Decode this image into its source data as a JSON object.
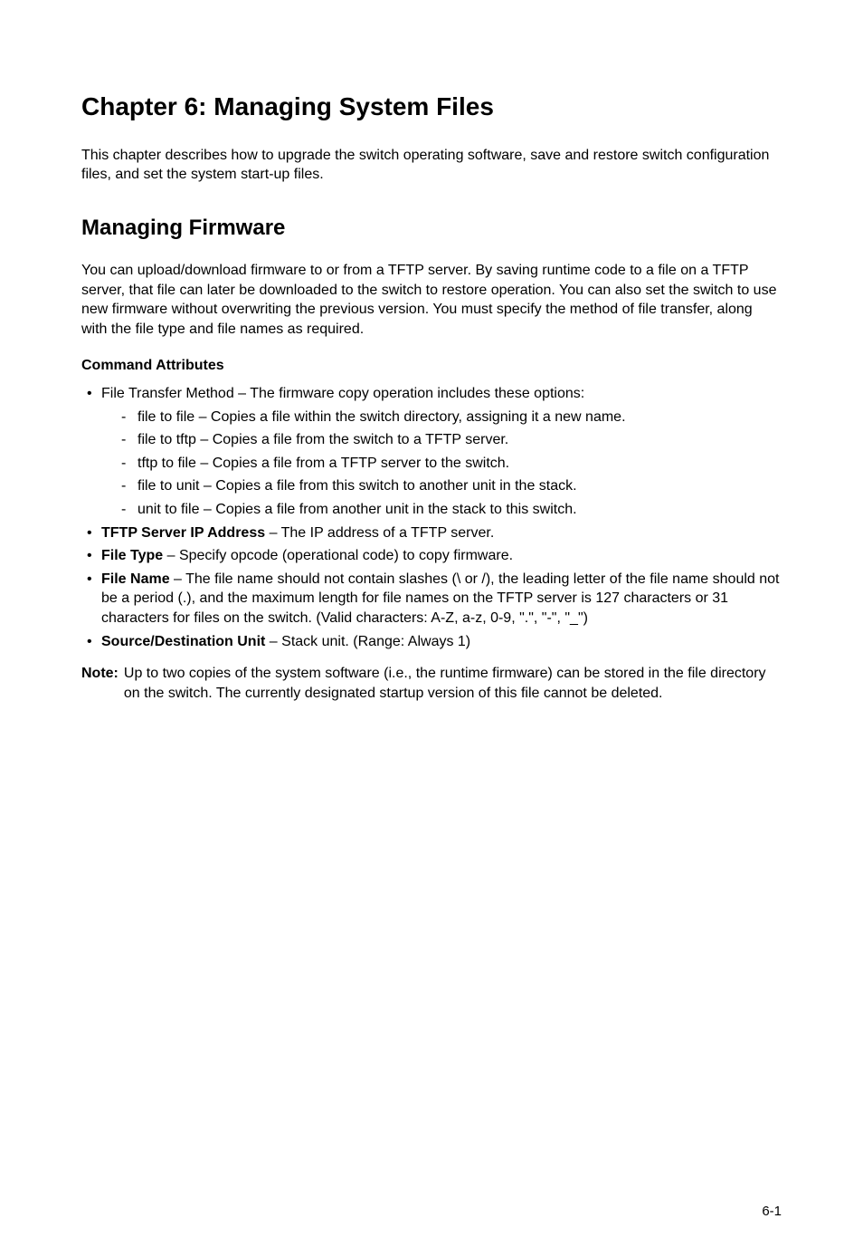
{
  "chapter": {
    "title": "Chapter 6: Managing System Files",
    "intro": "This chapter describes how to upgrade the switch operating software, save and restore switch configuration files, and set the system start-up files."
  },
  "section": {
    "title": "Managing Firmware",
    "para": "You can upload/download firmware to or from a TFTP server. By saving runtime code to a file on a TFTP server, that file can later be downloaded to the switch to restore operation. You can also set the switch to use new firmware without overwriting the previous version. You must specify the method of file transfer, along with the file type and file names as required."
  },
  "attributes": {
    "heading": "Command Attributes",
    "items": [
      {
        "lead": "File Transfer Method – The firmware copy operation includes these options:",
        "sub": [
          "file to file – Copies a file within the switch directory, assigning it a new name.",
          "file to tftp – Copies a file from the switch to a TFTP server.",
          "tftp to file – Copies a file from a TFTP server to the switch.",
          "file to unit – Copies a file from this switch to another unit in the stack.",
          "unit to file – Copies a file from another unit in the stack to this switch."
        ]
      },
      {
        "bold": "TFTP Server IP Address",
        "tail": " – The IP address of a TFTP server."
      },
      {
        "bold": "File Type",
        "tail": " – Specify opcode (operational code) to copy firmware."
      },
      {
        "bold": "File Name",
        "tail": " – The file name should not contain slashes (\\ or /), the leading letter of the file name should not be a period (.), and the maximum length for file names on the TFTP server is 127 characters or 31 characters for files on the switch. (Valid characters: A-Z, a-z, 0-9, \".\", \"-\", \"_\")"
      },
      {
        "bold": "Source/Destination Unit",
        "tail": " – Stack unit. (Range: Always 1)"
      }
    ]
  },
  "note": {
    "label": "Note:",
    "text": "Up to two copies of the system software (i.e., the runtime firmware) can be stored in the file directory on the switch. The currently designated startup version of this file cannot be deleted."
  },
  "footer": {
    "page": "6-1"
  }
}
